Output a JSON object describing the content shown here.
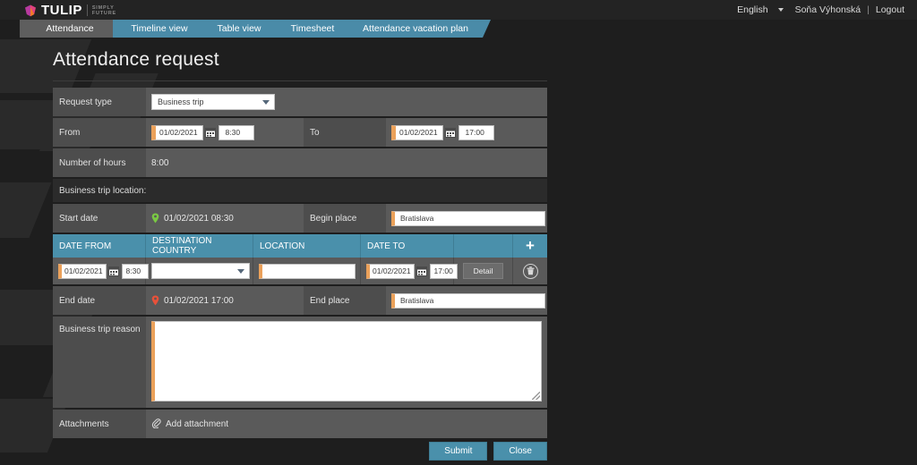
{
  "brand": {
    "name": "TULIP",
    "tagline_line1": "SIMPLY",
    "tagline_line2": "FUTURE",
    "logo_color": "#e0427f",
    "accent_blue": "#4a90ab",
    "accent_orange": "#eba15a"
  },
  "header": {
    "language": "English",
    "user_name": "Soňa Výhonská",
    "separator": "|",
    "logout": "Logout"
  },
  "tabs": [
    {
      "label": "Attendance",
      "active": true
    },
    {
      "label": "Timeline view",
      "active": false
    },
    {
      "label": "Table view",
      "active": false
    },
    {
      "label": "Timesheet",
      "active": false
    },
    {
      "label": "Attendance vacation plan",
      "active": false
    }
  ],
  "page": {
    "title": "Attendance request"
  },
  "form": {
    "request_type": {
      "label": "Request type",
      "value": "Business trip"
    },
    "from": {
      "label": "From",
      "date": "01/02/2021",
      "time": "8:30"
    },
    "to": {
      "label": "To",
      "date": "01/02/2021",
      "time": "17:00"
    },
    "number_of_hours": {
      "label": "Number of hours",
      "value": "8:00"
    },
    "section_title": "Business trip location:",
    "start_date": {
      "label": "Start date",
      "value": "01/02/2021 08:30",
      "pin_color": "#7ac943"
    },
    "begin_place": {
      "label": "Begin place",
      "value": "Bratislava"
    },
    "end_date": {
      "label": "End date",
      "value": "01/02/2021 17:00",
      "pin_color": "#e8513a"
    },
    "end_place": {
      "label": "End place",
      "value": "Bratislava"
    },
    "reason": {
      "label": "Business trip reason",
      "value": "",
      "placeholder": ""
    },
    "attachments": {
      "label": "Attachments",
      "add_label": "Add attachment"
    }
  },
  "trip_table": {
    "columns": [
      {
        "label": "DATE FROM"
      },
      {
        "label": "DESTINATION COUNTRY"
      },
      {
        "label": "LOCATION"
      },
      {
        "label": "DATE TO"
      },
      {
        "label": ""
      },
      {
        "label": "+"
      }
    ],
    "rows": [
      {
        "date_from": "01/02/2021",
        "time_from": "8:30",
        "destination_country": "",
        "location": "",
        "date_to": "01/02/2021",
        "time_to": "17:00",
        "detail_label": "Detail"
      }
    ]
  },
  "footer": {
    "submit_label": "Submit",
    "close_label": "Close"
  }
}
